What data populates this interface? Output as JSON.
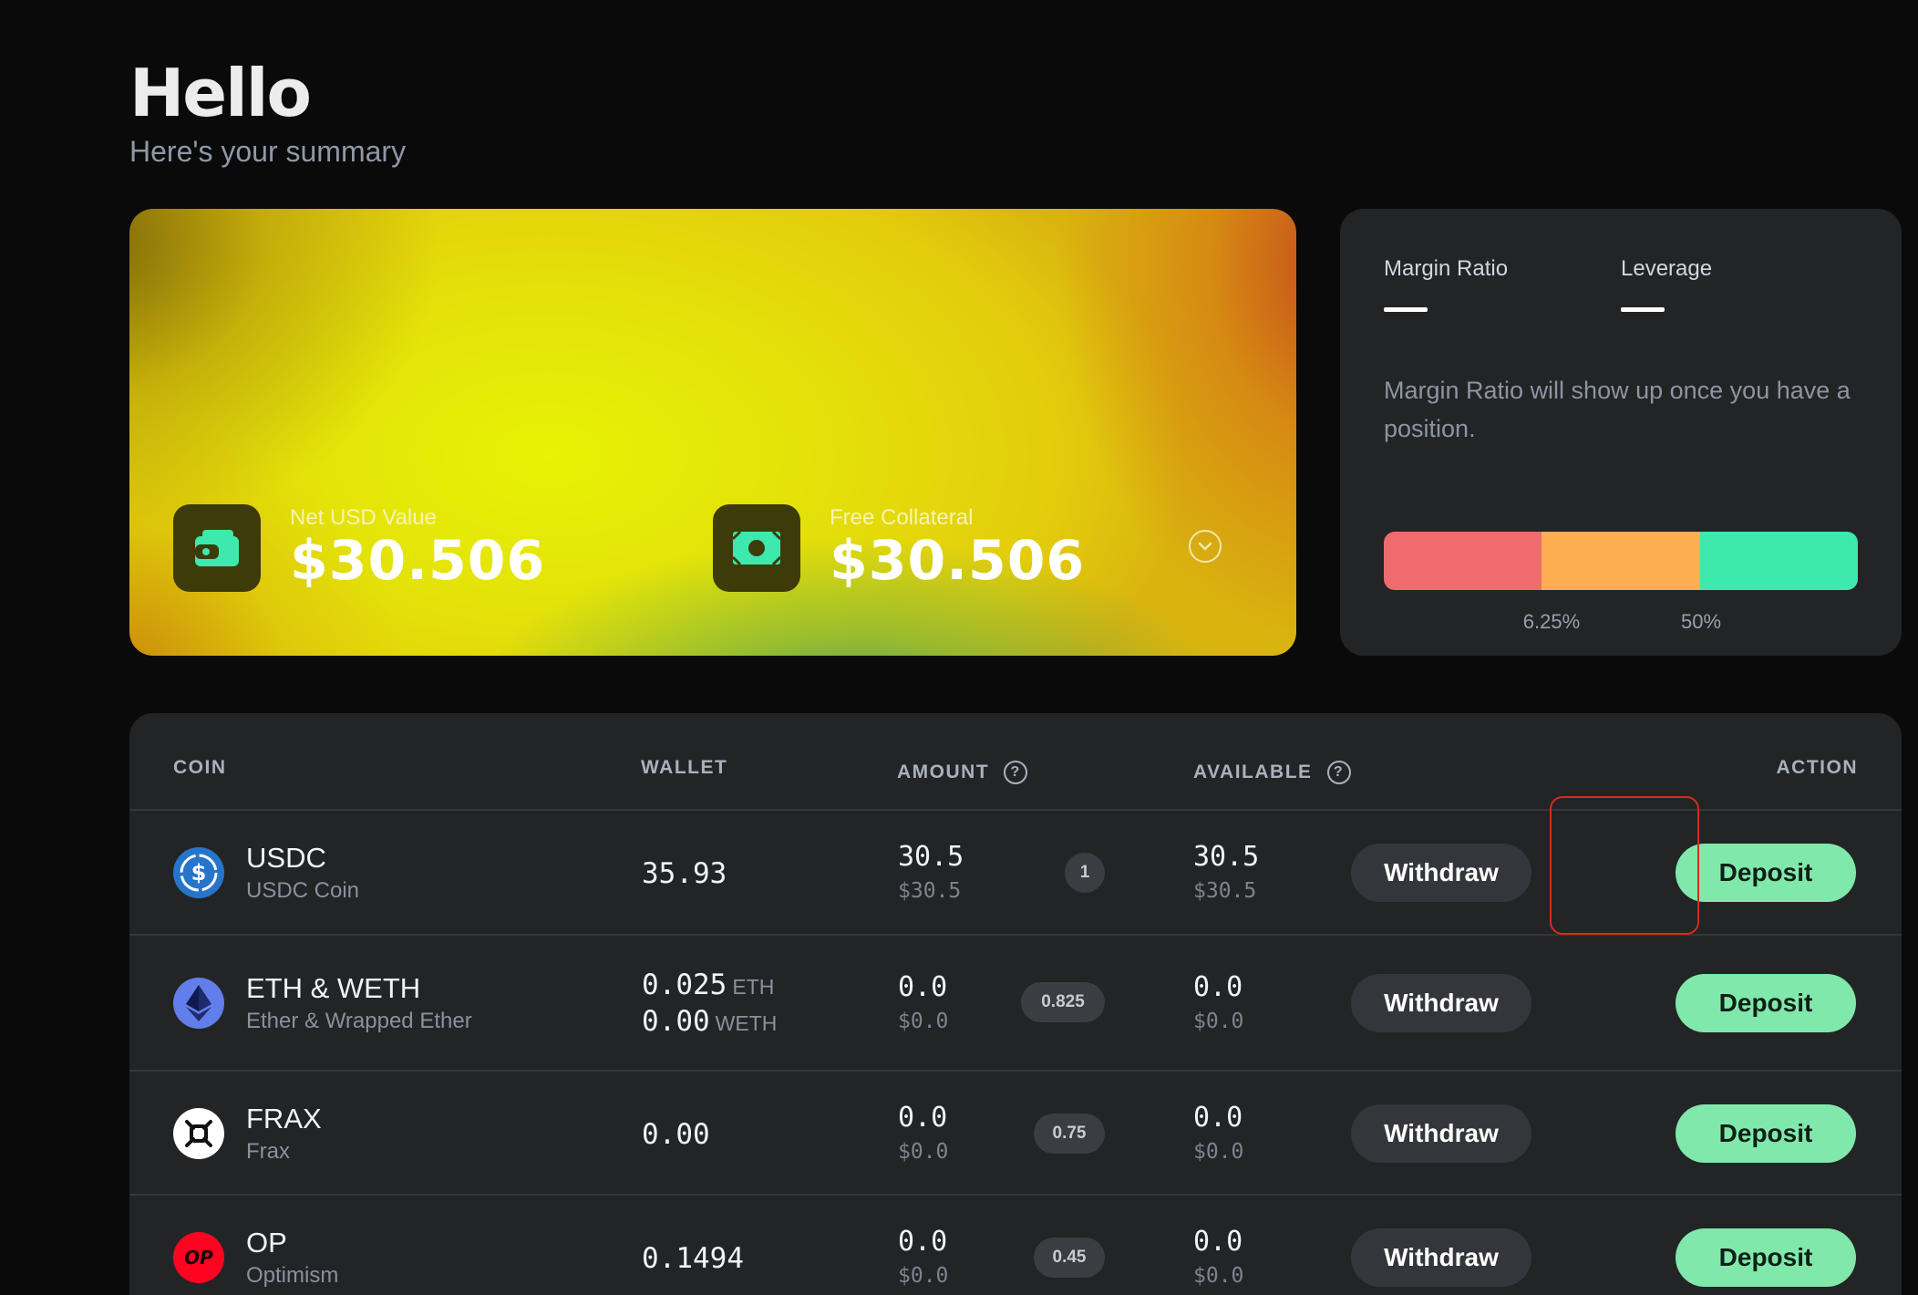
{
  "header": {
    "title": "Hello",
    "subtitle": "Here's your summary"
  },
  "summary": {
    "net_usd_label": "Net USD Value",
    "net_usd_value": "$30.506",
    "free_collateral_label": "Free Collateral",
    "free_collateral_value": "$30.506"
  },
  "margin": {
    "tabs": [
      "Margin Ratio",
      "Leverage"
    ],
    "note": "Margin Ratio will show up once you have a position.",
    "ticks": [
      "6.25%",
      "50%"
    ],
    "colors": {
      "danger": "#ef6b6e",
      "warning": "#fdae51",
      "safe": "#3de9ad"
    }
  },
  "table": {
    "headers": {
      "coin": "COIN",
      "wallet": "WALLET",
      "amount": "AMOUNT",
      "available": "AVAILABLE",
      "action": "ACTION"
    },
    "help_glyph": "?",
    "rows": [
      {
        "symbol": "USDC",
        "name": "USDC Coin",
        "icon": "usdc-icon",
        "wallet": "35.93",
        "wallet_unit": "",
        "wallet2": "",
        "wallet2_unit": "",
        "amount": "30.5",
        "amount_usd": "$30.5",
        "weight": "1",
        "available": "30.5",
        "available_usd": "$30.5",
        "withdraw": "Withdraw",
        "deposit": "Deposit"
      },
      {
        "symbol": "ETH & WETH",
        "name": "Ether & Wrapped Ether",
        "icon": "eth-icon",
        "wallet": "0.025",
        "wallet_unit": "ETH",
        "wallet2": "0.00",
        "wallet2_unit": "WETH",
        "amount": "0.0",
        "amount_usd": "$0.0",
        "weight": "0.825",
        "available": "0.0",
        "available_usd": "$0.0",
        "withdraw": "Withdraw",
        "deposit": "Deposit"
      },
      {
        "symbol": "FRAX",
        "name": "Frax",
        "icon": "frax-icon",
        "wallet": "0.00",
        "wallet_unit": "",
        "wallet2": "",
        "wallet2_unit": "",
        "amount": "0.0",
        "amount_usd": "$0.0",
        "weight": "0.75",
        "available": "0.0",
        "available_usd": "$0.0",
        "withdraw": "Withdraw",
        "deposit": "Deposit"
      },
      {
        "symbol": "OP",
        "name": "Optimism",
        "icon": "op-icon",
        "icon_text": "OP",
        "wallet": "0.1494",
        "wallet_unit": "",
        "wallet2": "",
        "wallet2_unit": "",
        "amount": "0.0",
        "amount_usd": "$0.0",
        "weight": "0.45",
        "available": "0.0",
        "available_usd": "$0.0",
        "withdraw": "Withdraw",
        "deposit": "Deposit"
      }
    ]
  },
  "colors": {
    "background": "#0a0a0b",
    "card": "#232426",
    "deposit": "#80e8aa",
    "withdraw": "#34363b",
    "highlight": "#d62c1c"
  }
}
